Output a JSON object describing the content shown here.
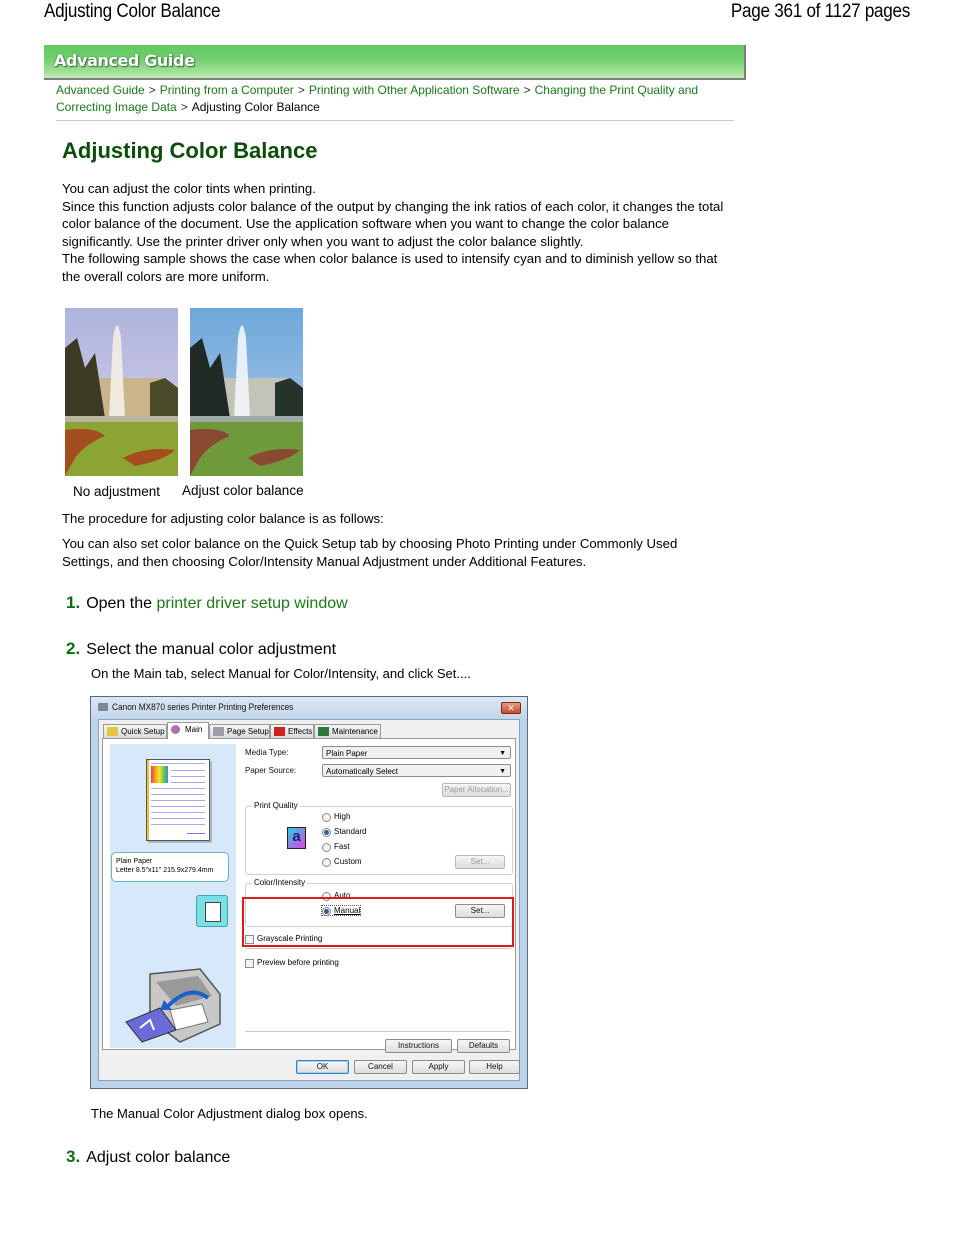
{
  "page_header": {
    "title": "Adjusting Color Balance",
    "page_count": "Page 361 of 1127 pages"
  },
  "banner": {
    "label": "Advanced Guide",
    "color": "#6ccf6a"
  },
  "breadcrumb": {
    "links": [
      "Advanced Guide",
      "Printing from a Computer",
      "Printing with Other Application Software",
      "Changing the Print Quality and Correcting Image Data"
    ],
    "separator": ">",
    "current": "Adjusting Color Balance",
    "link_color": "#1a7a1a"
  },
  "article": {
    "title": "Adjusting Color Balance",
    "title_color": "#0b4d0b",
    "intro": [
      "You can adjust the color tints when printing.",
      "Since this function adjusts color balance of the output by changing the ink ratios of each color, it changes the total color balance of the document. Use the application software when you want to change the color balance significantly. Use the printer driver only when you want to adjust the color balance slightly.",
      "The following sample shows the case when color balance is used to intensify cyan and to diminish yellow so that the overall colors are more uniform."
    ],
    "samples": [
      {
        "caption": "No adjustment",
        "image": "fountain-photo-warm"
      },
      {
        "caption": "Adjust color balance",
        "image": "fountain-photo-cool"
      }
    ],
    "procedure_intro": "The procedure for adjusting color balance is as follows:",
    "note": "You can also set color balance on the Quick Setup tab by choosing Photo Printing under Commonly Used Settings, and then choosing Color/Intensity Manual Adjustment under Additional Features.",
    "steps": [
      {
        "number": "1.",
        "prefix": "Open the ",
        "link": "printer driver setup window"
      },
      {
        "number": "2.",
        "text": "Select the manual color adjustment",
        "description": "On the Main tab, select Manual for Color/Intensity, and click Set....",
        "after": "The Manual Color Adjustment dialog box opens."
      },
      {
        "number": "3.",
        "text": "Adjust color balance"
      }
    ]
  },
  "dialog": {
    "title": "Canon MX870 series Printer Printing Preferences",
    "close_label": "✕",
    "tabs": [
      "Quick Setup",
      "Main",
      "Page Setup",
      "Effects",
      "Maintenance"
    ],
    "active_tab": "Main",
    "paper_info": [
      "Plain Paper",
      "Letter 8.5\"x11\" 215.9x279.4mm"
    ],
    "media_type_label": "Media Type:",
    "media_type_value": "Plain Paper",
    "paper_source_label": "Paper Source:",
    "paper_source_value": "Automatically Select",
    "paper_allocation_button": "Paper Allocation...",
    "print_quality": {
      "label": "Print Quality",
      "options": [
        "High",
        "Standard",
        "Fast",
        "Custom"
      ],
      "selected": "Standard",
      "set_button": "Set..."
    },
    "color_intensity": {
      "label": "Color/Intensity",
      "options": [
        "Auto",
        "Manual"
      ],
      "selected": "Manual",
      "set_button": "Set..."
    },
    "grayscale_label": "Grayscale Printing",
    "preview_label": "Preview before printing",
    "instructions_button": "Instructions",
    "defaults_button": "Defaults",
    "ok_button": "OK",
    "cancel_button": "Cancel",
    "apply_button": "Apply",
    "help_button": "Help",
    "highlight_color": "#e0191d"
  }
}
